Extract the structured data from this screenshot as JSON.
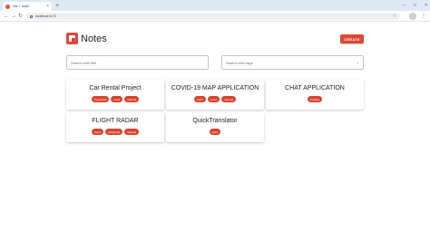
{
  "browser": {
    "tab_title": "vite + react",
    "tab_close": "×",
    "new_tab": "+",
    "window_controls": [
      "–",
      "□",
      "×"
    ],
    "back": "←",
    "forward": "→",
    "reload": "↻",
    "url": "localhost:5173",
    "bookmark_star": "☆",
    "menu": "⋮"
  },
  "app": {
    "logo_icon": "notes-logo-icon",
    "title": "Notes",
    "create_label": "CREATE",
    "accent_color": "#df4736"
  },
  "filters": {
    "title_placeholder": "Search with title",
    "tags_placeholder": "Search with tags",
    "tags_caret": "⌄"
  },
  "notes": [
    {
      "title": "Car Rental Project",
      "tags": [
        "Typescript",
        "react",
        "tailwind"
      ]
    },
    {
      "title": "COVID-19 MAP APPLICATION",
      "tags": [
        "react",
        "redux",
        "rest-api"
      ]
    },
    {
      "title": "CHAT APPLICATION",
      "tags": [
        "firebase"
      ]
    },
    {
      "title": "FLIGHT RADAR",
      "tags": [
        "redux",
        "javascript",
        "tailwind"
      ]
    },
    {
      "title": "QuickTranslator",
      "tags": [
        "react"
      ]
    }
  ]
}
